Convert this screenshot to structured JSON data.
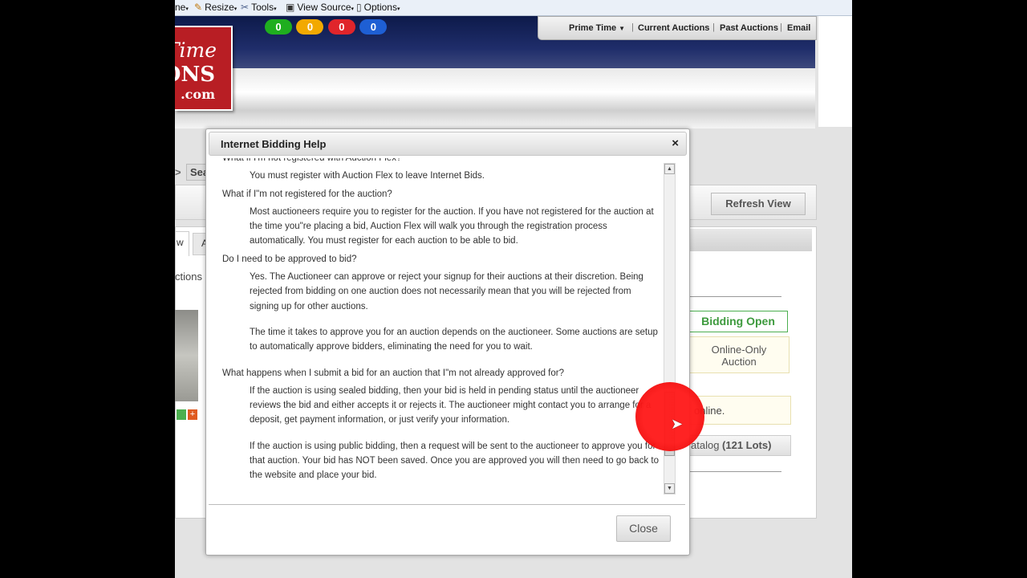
{
  "toolbar": {
    "items": [
      {
        "label": "ne",
        "icon": "dropdown-arrow-icon"
      },
      {
        "label": "Resize",
        "icon": "pencil-icon"
      },
      {
        "label": "Tools",
        "icon": "wrench-icon"
      },
      {
        "label": "View Source",
        "icon": "monitor-icon"
      },
      {
        "label": "Options",
        "icon": "page-icon"
      }
    ]
  },
  "header": {
    "logo": {
      "line1": "Time",
      "line2": "ONS",
      "line3": ".com"
    },
    "badges": [
      {
        "value": "0",
        "color": "#1fae1f"
      },
      {
        "value": "0",
        "color": "#f2a900"
      },
      {
        "value": "0",
        "color": "#e0252b"
      },
      {
        "value": "0",
        "color": "#1e5fd4"
      }
    ],
    "nav": [
      "Prime Time",
      "Current Auctions",
      "Past Auctions",
      "Email"
    ],
    "nav_separator": "|"
  },
  "background": {
    "search_arrow": ">",
    "search_label": "Sea",
    "refresh_label": "Refresh View",
    "tab1": "w",
    "tab2": "A",
    "left_text": "ctions",
    "bidding_open": "Bidding Open",
    "online_only_line1": "Online-Only",
    "online_only_line2": "Auction",
    "online_note": "online.",
    "catalog_prefix": "atalog",
    "catalog_count": "(121 Lots)"
  },
  "dialog": {
    "title": "Internet Bidding Help",
    "close_x": "×",
    "close_label": "Close",
    "faq": [
      {
        "q": "What if I'm not registered with Auction Flex?",
        "a": [
          "You must register with Auction Flex to leave Internet Bids."
        ]
      },
      {
        "q": "What if I\"m not registered for the auction?",
        "a": [
          "Most auctioneers require you to register for the auction. If you have not registered for the auction at the time you\"re placing a bid, Auction Flex will walk you through the registration process automatically. You must register for each auction to be able to bid."
        ]
      },
      {
        "q": "Do I need to be approved to bid?",
        "a": [
          "Yes. The Auctioneer can approve or reject your signup for their auctions at their discretion. Being rejected from bidding on one auction does not necessarily mean that you will be rejected from signing up for other auctions.",
          "The time it takes to approve you for an auction depends on the auctioneer. Some auctions are setup to automatically approve bidders, eliminating the need for you to wait."
        ]
      },
      {
        "q": "What happens when I submit a bid for an auction that I\"m not already approved for?",
        "a": [
          "If the auction is using sealed bidding, then your bid is held in pending status until the auctioneer reviews the bid and either accepts it or rejects it. The auctioneer might contact you to arrange for a deposit, get payment information, or just verify your information.",
          "If the auction is using public bidding, then a request will be sent to the auctioneer to approve you for that auction. Your bid has NOT been saved. Once you are approved you will then need to go back to the website and place your bid."
        ]
      }
    ]
  }
}
